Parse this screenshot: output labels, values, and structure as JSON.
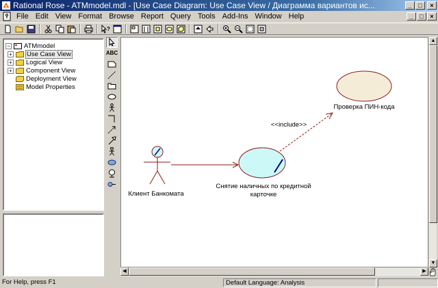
{
  "window": {
    "title": "Rational Rose - ATMmodel.mdl - [Use Case Diagram: Use Case View / Диаграмма вариантов ис...",
    "controls": [
      "_",
      "□",
      "×"
    ]
  },
  "menu": {
    "items": [
      "File",
      "Edit",
      "View",
      "Format",
      "Browse",
      "Report",
      "Query",
      "Tools",
      "Add-Ins",
      "Window",
      "Help"
    ],
    "mdi_controls": [
      "_",
      "□",
      "×"
    ]
  },
  "browser": {
    "root": "ATMmodel",
    "items": [
      {
        "label": "Use Case View",
        "expander": "+",
        "selected": true,
        "icon": "folder-icon"
      },
      {
        "label": "Logical View",
        "expander": "+",
        "selected": false,
        "icon": "folder-icon"
      },
      {
        "label": "Component View",
        "expander": "+",
        "selected": false,
        "icon": "folder-icon"
      },
      {
        "label": "Deployment View",
        "expander": "",
        "selected": false,
        "icon": "deployment-icon"
      },
      {
        "label": "Model Properties",
        "expander": "",
        "selected": false,
        "icon": "properties-icon"
      }
    ]
  },
  "palette": {
    "text_tool": "ABC"
  },
  "diagram": {
    "actor_label": "Клиент Банкомата",
    "usecase_main_line1": "Снятие наличных по кредитной",
    "usecase_main_line2": "карточке",
    "usecase_pin": "Проверка ПИН-кода",
    "include_stereotype": "<<include>>",
    "colors": {
      "usecase_fill_main": "#cdf8f8",
      "usecase_fill_pin": "#f5ecd7",
      "border": "#8b1a1a"
    }
  },
  "status": {
    "help": "For Help, press F1",
    "language": "Default Language: Analysis"
  }
}
